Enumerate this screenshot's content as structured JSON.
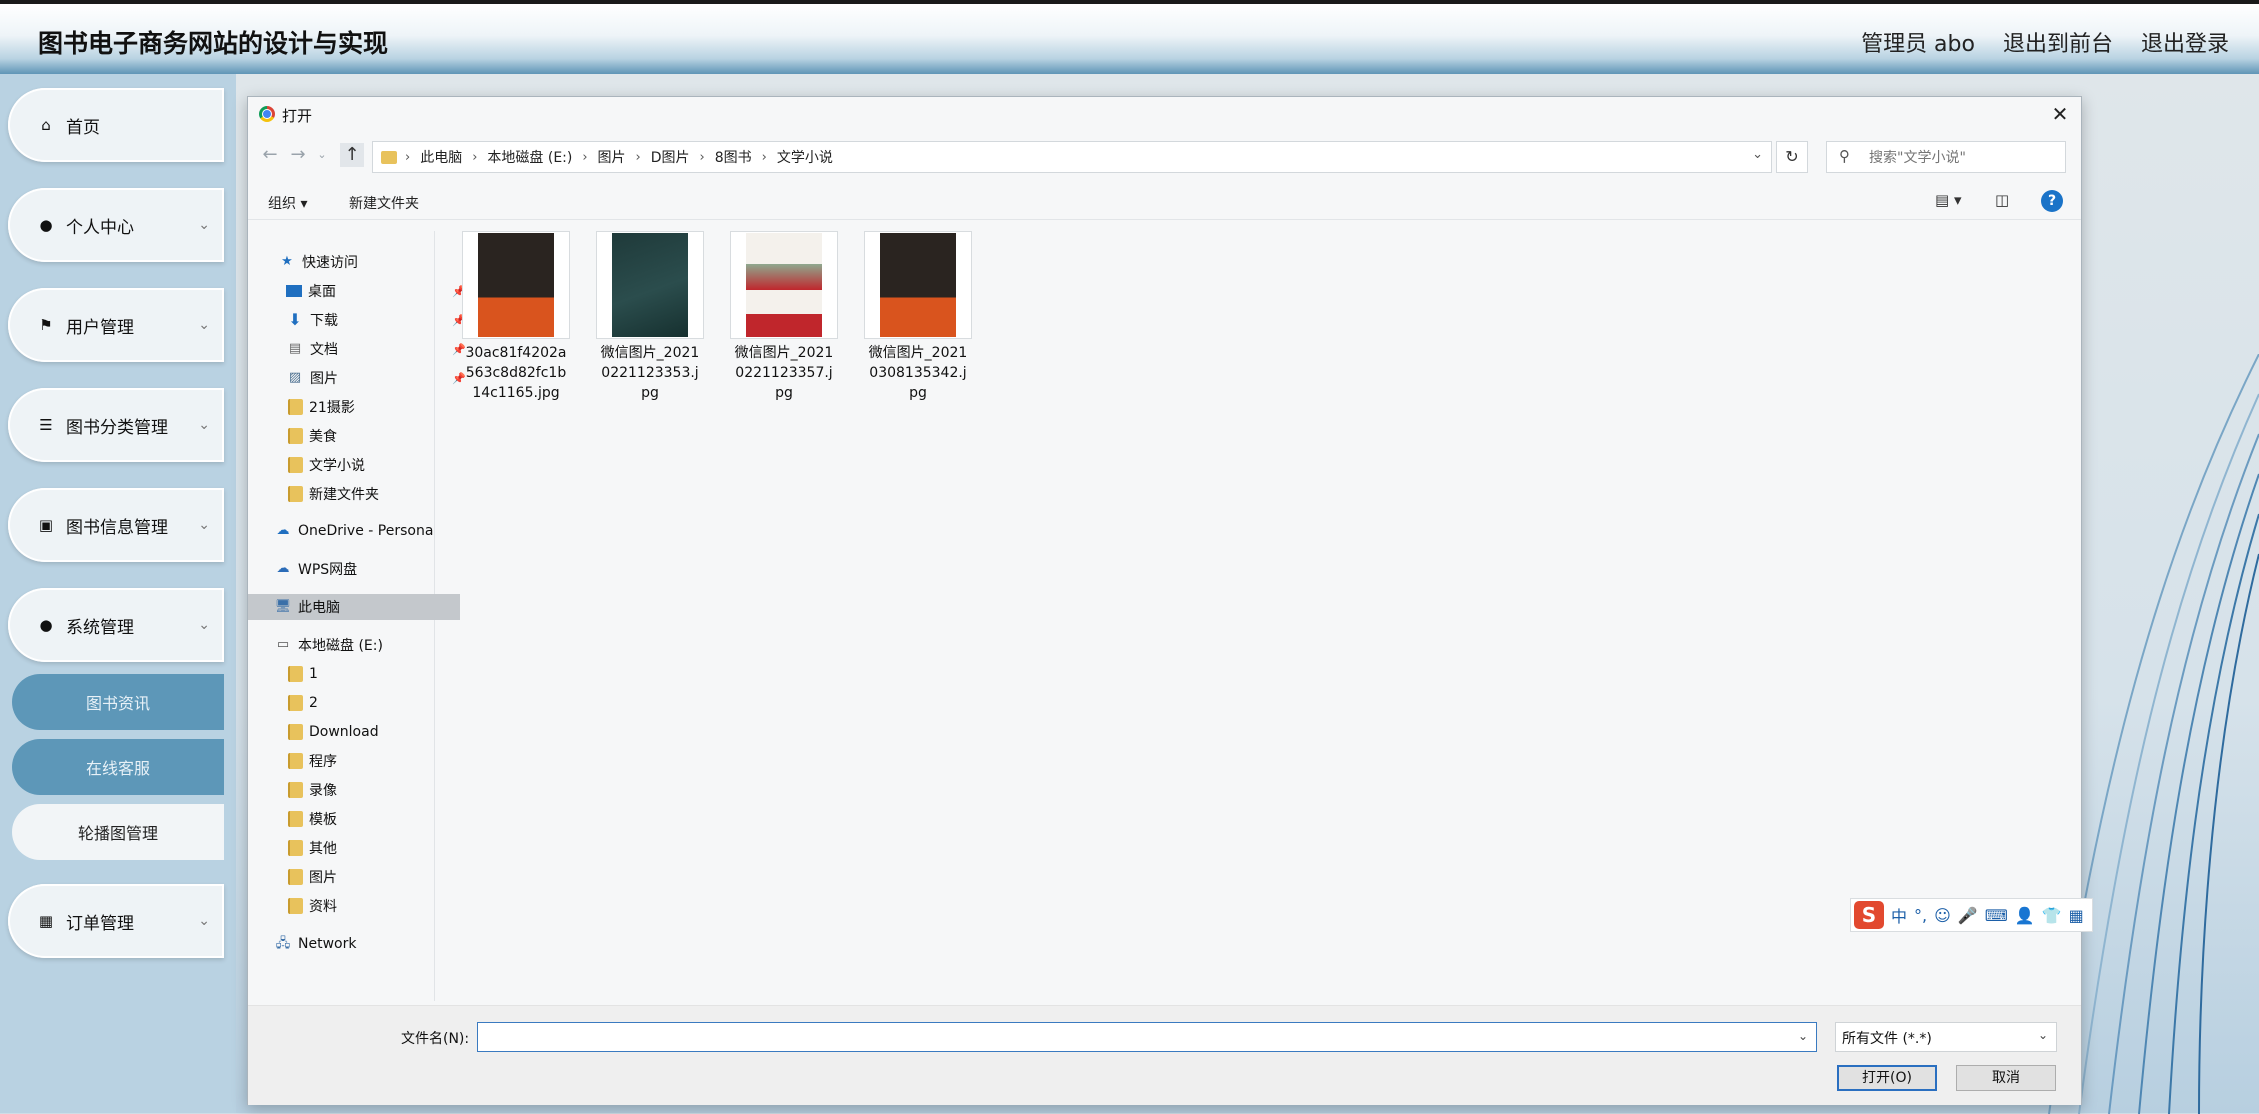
{
  "app": {
    "title": "图书电子商务网站的设计与实现",
    "header_links": [
      "管理员 abo",
      "退出到前台",
      "退出登录"
    ]
  },
  "sidebar": {
    "items": [
      {
        "label": "首页",
        "icon": "home-icon",
        "chevron": false
      },
      {
        "label": "个人中心",
        "icon": "user-icon",
        "chevron": true
      },
      {
        "label": "用户管理",
        "icon": "flag-icon",
        "chevron": true
      },
      {
        "label": "图书分类管理",
        "icon": "sliders-icon",
        "chevron": true
      },
      {
        "label": "图书信息管理",
        "icon": "chat-icon",
        "chevron": true
      },
      {
        "label": "系统管理",
        "icon": "user-icon",
        "chevron": true
      }
    ],
    "sub_items": [
      "图书资讯",
      "在线客服",
      "轮播图管理"
    ],
    "last_item": {
      "label": "订单管理",
      "icon": "grid-icon",
      "chevron": true
    }
  },
  "dialog": {
    "title": "打开",
    "breadcrumbs": [
      "此电脑",
      "本地磁盘 (E:)",
      "图片",
      "D图片",
      "8图书",
      "文学小说"
    ],
    "search_placeholder": "搜索\"文学小说\"",
    "commands": {
      "organize": "组织 ▾",
      "new_folder": "新建文件夹"
    },
    "nav": {
      "quick_access": "快速访问",
      "quick_items": [
        "桌面",
        "下载",
        "文档",
        "图片",
        "21摄影",
        "美食",
        "文学小说",
        "新建文件夹"
      ],
      "onedrive": "OneDrive - Persona",
      "wps": "WPS网盘",
      "this_pc": "此电脑",
      "local_disk": "本地磁盘 (E:)",
      "disk_folders": [
        "1",
        "2",
        "Download",
        "程序",
        "录像",
        "模板",
        "其他",
        "图片",
        "资料"
      ],
      "network": "Network"
    },
    "files": [
      {
        "name": "30ac81f4202a563c8d82fc1b14c1165.jpg",
        "cover_color": "#2a2420",
        "accent": "#d9541e"
      },
      {
        "name": "微信图片_20210221123353.jpg",
        "cover_color": "#1f3a3a",
        "accent": "#3c6b6b"
      },
      {
        "name": "微信图片_20210221123357.jpg",
        "cover_color": "#f4f1ec",
        "accent": "#c0262c"
      },
      {
        "name": "微信图片_20210308135342.jpg",
        "cover_color": "#2a2420",
        "accent": "#d9541e"
      }
    ],
    "footer": {
      "filename_label": "文件名(N):",
      "filename_value": "",
      "filter": "所有文件 (*.*)",
      "open_button": "打开(O)",
      "cancel_button": "取消"
    }
  },
  "ime": {
    "items": [
      "中",
      "°,",
      "☺",
      "🎤",
      "⌨",
      "👤",
      "👕",
      "▦"
    ]
  }
}
